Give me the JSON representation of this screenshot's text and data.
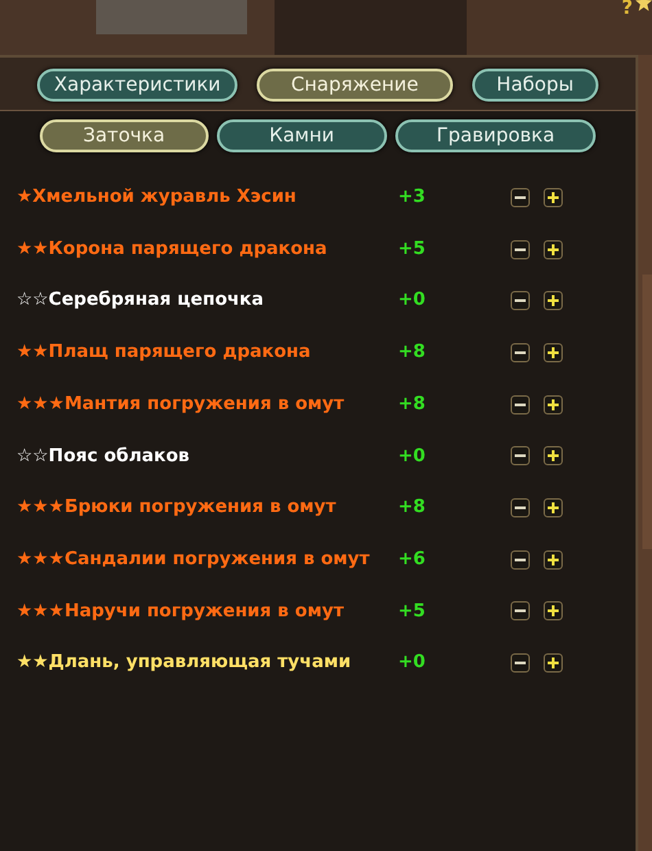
{
  "help": {
    "label": "?"
  },
  "main_tabs": [
    {
      "label": "Характеристики",
      "selected": false
    },
    {
      "label": "Снаряжение",
      "selected": true
    },
    {
      "label": "Наборы",
      "selected": false
    }
  ],
  "sub_tabs": [
    {
      "label": "Заточка",
      "selected": true
    },
    {
      "label": "Камни",
      "selected": false
    },
    {
      "label": "Гравировка",
      "selected": false
    }
  ],
  "items": [
    {
      "rank": "★",
      "name": "Хмельной журавль Хэсин",
      "color": "#ff6a13",
      "bonus": "+3"
    },
    {
      "rank": "★★",
      "name": "Корона парящего дракона",
      "color": "#ff6a13",
      "bonus": "+5"
    },
    {
      "rank": "☆☆",
      "name": "Серебряная цепочка",
      "color": "#ffffff",
      "bonus": "+0"
    },
    {
      "rank": "★★",
      "name": "Плащ парящего дракона",
      "color": "#ff6a13",
      "bonus": "+8"
    },
    {
      "rank": "★★★",
      "name": "Мантия погружения в омут",
      "color": "#ff6a13",
      "bonus": "+8"
    },
    {
      "rank": "☆☆",
      "name": "Пояс облаков",
      "color": "#ffffff",
      "bonus": "+0"
    },
    {
      "rank": "★★★",
      "name": "Брюки погружения в омут",
      "color": "#ff6a13",
      "bonus": "+8"
    },
    {
      "rank": "★★★",
      "name": "Сандалии погружения в омут",
      "color": "#ff6a13",
      "bonus": "+6"
    },
    {
      "rank": "★★★",
      "name": "Наручи погружения в омут",
      "color": "#ff6a13",
      "bonus": "+5"
    },
    {
      "rank": "★★",
      "name": "Длань, управляющая тучами",
      "color": "#ffe066",
      "bonus": "+0"
    }
  ]
}
